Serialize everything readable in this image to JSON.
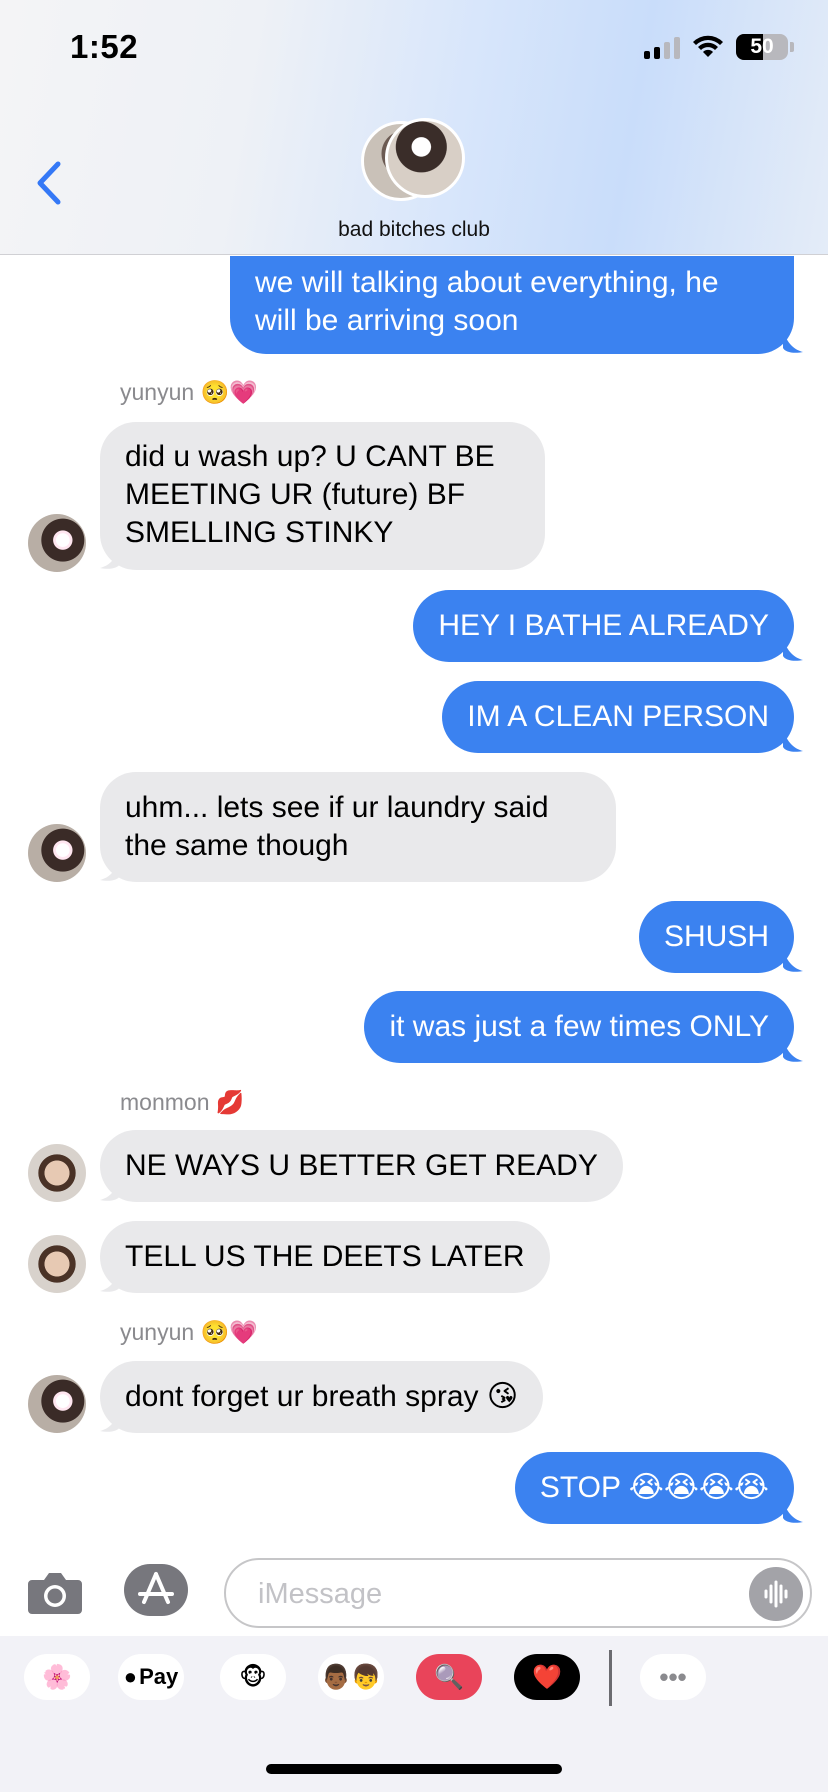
{
  "status_bar": {
    "time": "1:52",
    "battery": "50"
  },
  "header": {
    "group_name": "bad bitches club"
  },
  "messages": [
    {
      "text_lines": [
        "we will talking about everything, he",
        "will be arriving soon"
      ]
    },
    {
      "sender": "yunyun 🥺💗",
      "text_lines": [
        "did u wash up? U CANT BE",
        "MEETING UR (future) BF",
        "SMELLING STINKY"
      ]
    },
    {
      "text": "HEY I BATHE ALREADY"
    },
    {
      "text": "IM A CLEAN PERSON"
    },
    {
      "text_lines": [
        "uhm... lets see if ur laundry said",
        "the same though"
      ]
    },
    {
      "text": "SHUSH"
    },
    {
      "text": "it was just a few times ONLY"
    },
    {
      "sender": "monmon 💋",
      "text": "NE WAYS U BETTER GET READY"
    },
    {
      "text": "TELL US THE DEETS LATER"
    },
    {
      "sender": "yunyun 🥺💗",
      "text": "dont forget ur breath spray 😘"
    },
    {
      "text": "STOP 😭😭😭😭"
    }
  ],
  "input": {
    "placeholder": "iMessage"
  },
  "drawer": {
    "items": [
      {
        "label": "🌸",
        "icon": "photos-icon"
      },
      {
        "label": "Pay",
        "icon": "apple-pay-icon"
      },
      {
        "label": "🐵",
        "icon": "animoji-icon"
      },
      {
        "label": "👨🏾👦",
        "icon": "memoji-icon"
      },
      {
        "label": "🔍",
        "icon": "images-search-icon"
      },
      {
        "label": "❤️",
        "icon": "digital-touch-icon"
      },
      {
        "label": "•••",
        "icon": "more-icon"
      }
    ]
  },
  "colors": {
    "outgoing": "#3b82f0",
    "incoming": "#e9e9eb",
    "accent": "#3478f6"
  }
}
